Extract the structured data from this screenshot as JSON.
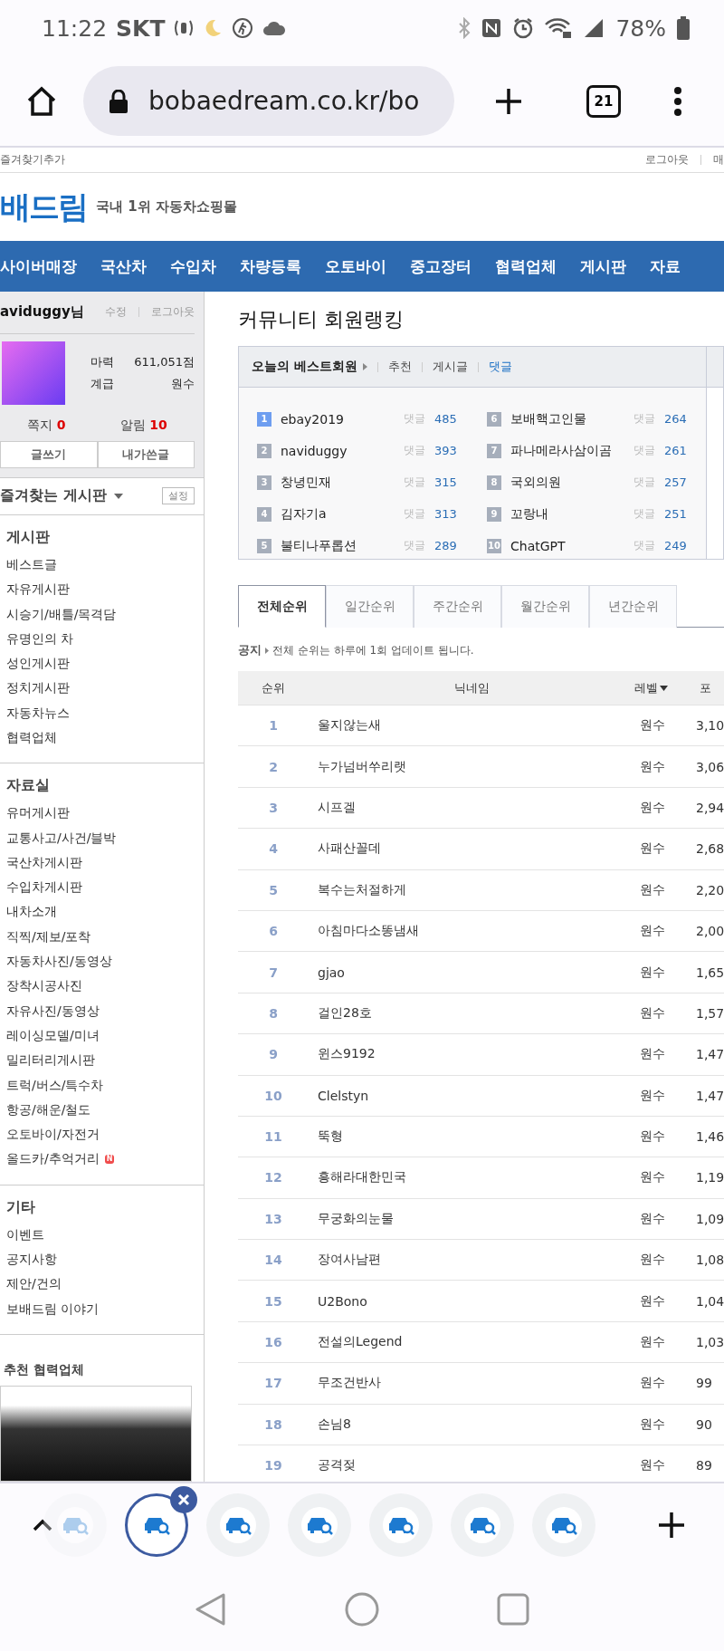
{
  "status_bar": {
    "time": "11:22",
    "carrier": "SKT",
    "battery": "78%"
  },
  "browser": {
    "url": "bobaedream.co.kr/bo",
    "tab_count": "21"
  },
  "util_bar": {
    "left": "즐겨찾기추가",
    "right": [
      "로그아웃",
      "매"
    ]
  },
  "header": {
    "logo": "배드림",
    "tagline": "국내 1위 자동차쇼핑몰"
  },
  "nav": [
    "사이버매장",
    "국산차",
    "수입차",
    "차량등록",
    "오토바이",
    "중고장터",
    "협력업체",
    "게시판",
    "자료"
  ],
  "user": {
    "name": "aviduggy님",
    "links": [
      "수정",
      "로그아웃"
    ],
    "stats": [
      {
        "label": "마력",
        "value": "611,051점"
      },
      {
        "label": "계급",
        "value": "원수"
      }
    ],
    "counters": [
      {
        "label": "쪽지",
        "value": "0"
      },
      {
        "label": "알림",
        "value": "10"
      }
    ],
    "buttons": [
      "글쓰기",
      "내가쓴글"
    ]
  },
  "favorites": {
    "title": "즐겨찾는 게시판",
    "settings": "설정"
  },
  "sidebar_sections": [
    {
      "title": "게시판",
      "items": [
        {
          "label": "베스트글"
        },
        {
          "label": "자유게시판"
        },
        {
          "label": "시승기/배틀/목격담"
        },
        {
          "label": "유명인의 차"
        },
        {
          "label": "성인게시판"
        },
        {
          "label": "정치게시판"
        },
        {
          "label": "자동차뉴스"
        },
        {
          "label": "협력업체"
        }
      ]
    },
    {
      "title": "자료실",
      "items": [
        {
          "label": "유머게시판"
        },
        {
          "label": "교통사고/사건/블박"
        },
        {
          "label": "국산차게시판"
        },
        {
          "label": "수입차게시판"
        },
        {
          "label": "내차소개"
        },
        {
          "label": "직찍/제보/포착"
        },
        {
          "label": "자동차사진/동영상"
        },
        {
          "label": "장착시공사진"
        },
        {
          "label": "자유사진/동영상"
        },
        {
          "label": "레이싱모델/미녀"
        },
        {
          "label": "밀리터리게시판"
        },
        {
          "label": "트럭/버스/특수차"
        },
        {
          "label": "항공/해운/철도"
        },
        {
          "label": "오토바이/자전거"
        },
        {
          "label": "올드카/추억거리",
          "badge": "N"
        }
      ]
    },
    {
      "title": "기타",
      "items": [
        {
          "label": "이벤트"
        },
        {
          "label": "공지사항"
        },
        {
          "label": "제안/건의"
        },
        {
          "label": "보배드림 이야기"
        }
      ]
    }
  ],
  "recommend": {
    "title": "추천 협력업체"
  },
  "page_title": "커뮤니티 회원랭킹",
  "best_members": {
    "title": "오늘의 베스트회원",
    "filters": [
      {
        "label": "추천",
        "selected": false
      },
      {
        "label": "게시글",
        "selected": false
      },
      {
        "label": "댓글",
        "selected": true
      }
    ],
    "members": [
      {
        "rank": "1",
        "name": "ebay2019",
        "label": "댓글",
        "count": "485",
        "top": true
      },
      {
        "rank": "2",
        "name": "naviduggy",
        "label": "댓글",
        "count": "393",
        "top": false
      },
      {
        "rank": "3",
        "name": "창녕민재",
        "label": "댓글",
        "count": "315",
        "top": false
      },
      {
        "rank": "4",
        "name": "김자기a",
        "label": "댓글",
        "count": "313",
        "top": false
      },
      {
        "rank": "5",
        "name": "불티나푸롭션",
        "label": "댓글",
        "count": "289",
        "top": false
      },
      {
        "rank": "6",
        "name": "보배핵고인물",
        "label": "댓글",
        "count": "264",
        "top": false
      },
      {
        "rank": "7",
        "name": "파나메라사삼이곰",
        "label": "댓글",
        "count": "261",
        "top": false
      },
      {
        "rank": "8",
        "name": "국외의원",
        "label": "댓글",
        "count": "257",
        "top": false
      },
      {
        "rank": "9",
        "name": "꼬랑내",
        "label": "댓글",
        "count": "251",
        "top": false
      },
      {
        "rank": "10",
        "name": "ChatGPT",
        "label": "댓글",
        "count": "249",
        "top": false
      }
    ]
  },
  "ranking_tabs": [
    {
      "label": "전체순위",
      "selected": true
    },
    {
      "label": "일간순위",
      "selected": false
    },
    {
      "label": "주간순위",
      "selected": false
    },
    {
      "label": "월간순위",
      "selected": false
    },
    {
      "label": "년간순위",
      "selected": false
    }
  ],
  "notice": {
    "label": "공지",
    "text": "전체 순위는 하루에 1회 업데이트 됩니다."
  },
  "table": {
    "columns": [
      "순위",
      "닉네임",
      "레벨",
      "포"
    ],
    "rows": [
      {
        "rank": "1",
        "nickname": "울지않는새",
        "level": "원수",
        "points": "3,10"
      },
      {
        "rank": "2",
        "nickname": "누가넘버쑤리랫",
        "level": "원수",
        "points": "3,06"
      },
      {
        "rank": "3",
        "nickname": "시프겔",
        "level": "원수",
        "points": "2,94"
      },
      {
        "rank": "4",
        "nickname": "사패산꼴데",
        "level": "원수",
        "points": "2,68"
      },
      {
        "rank": "5",
        "nickname": "복수는처절하게",
        "level": "원수",
        "points": "2,20"
      },
      {
        "rank": "6",
        "nickname": "아침마다소똥냄새",
        "level": "원수",
        "points": "2,00"
      },
      {
        "rank": "7",
        "nickname": "gjao",
        "level": "원수",
        "points": "1,65"
      },
      {
        "rank": "8",
        "nickname": "걸인28호",
        "level": "원수",
        "points": "1,57"
      },
      {
        "rank": "9",
        "nickname": "윈스9192",
        "level": "원수",
        "points": "1,47"
      },
      {
        "rank": "10",
        "nickname": "Clelstyn",
        "level": "원수",
        "points": "1,47"
      },
      {
        "rank": "11",
        "nickname": "뚝형",
        "level": "원수",
        "points": "1,46"
      },
      {
        "rank": "12",
        "nickname": "흥해라대한민국",
        "level": "원수",
        "points": "1,19"
      },
      {
        "rank": "13",
        "nickname": "무궁화의눈물",
        "level": "원수",
        "points": "1,09"
      },
      {
        "rank": "14",
        "nickname": "장여사남편",
        "level": "원수",
        "points": "1,08"
      },
      {
        "rank": "15",
        "nickname": "U2Bono",
        "level": "원수",
        "points": "1,04"
      },
      {
        "rank": "16",
        "nickname": "전설의Legend",
        "level": "원수",
        "points": "1,03"
      },
      {
        "rank": "17",
        "nickname": "무조건반사",
        "level": "원수",
        "points": "99"
      },
      {
        "rank": "18",
        "nickname": "손님8",
        "level": "원수",
        "points": "90"
      },
      {
        "rank": "19",
        "nickname": "공격젖",
        "level": "원수",
        "points": "89"
      }
    ]
  },
  "tab_strip": {
    "tabs": [
      {
        "selected": false,
        "faded": true
      },
      {
        "selected": true,
        "faded": false
      },
      {
        "selected": false,
        "faded": false
      },
      {
        "selected": false,
        "faded": false
      },
      {
        "selected": false,
        "faded": false
      },
      {
        "selected": false,
        "faded": false
      },
      {
        "selected": false,
        "faded": false
      }
    ]
  }
}
